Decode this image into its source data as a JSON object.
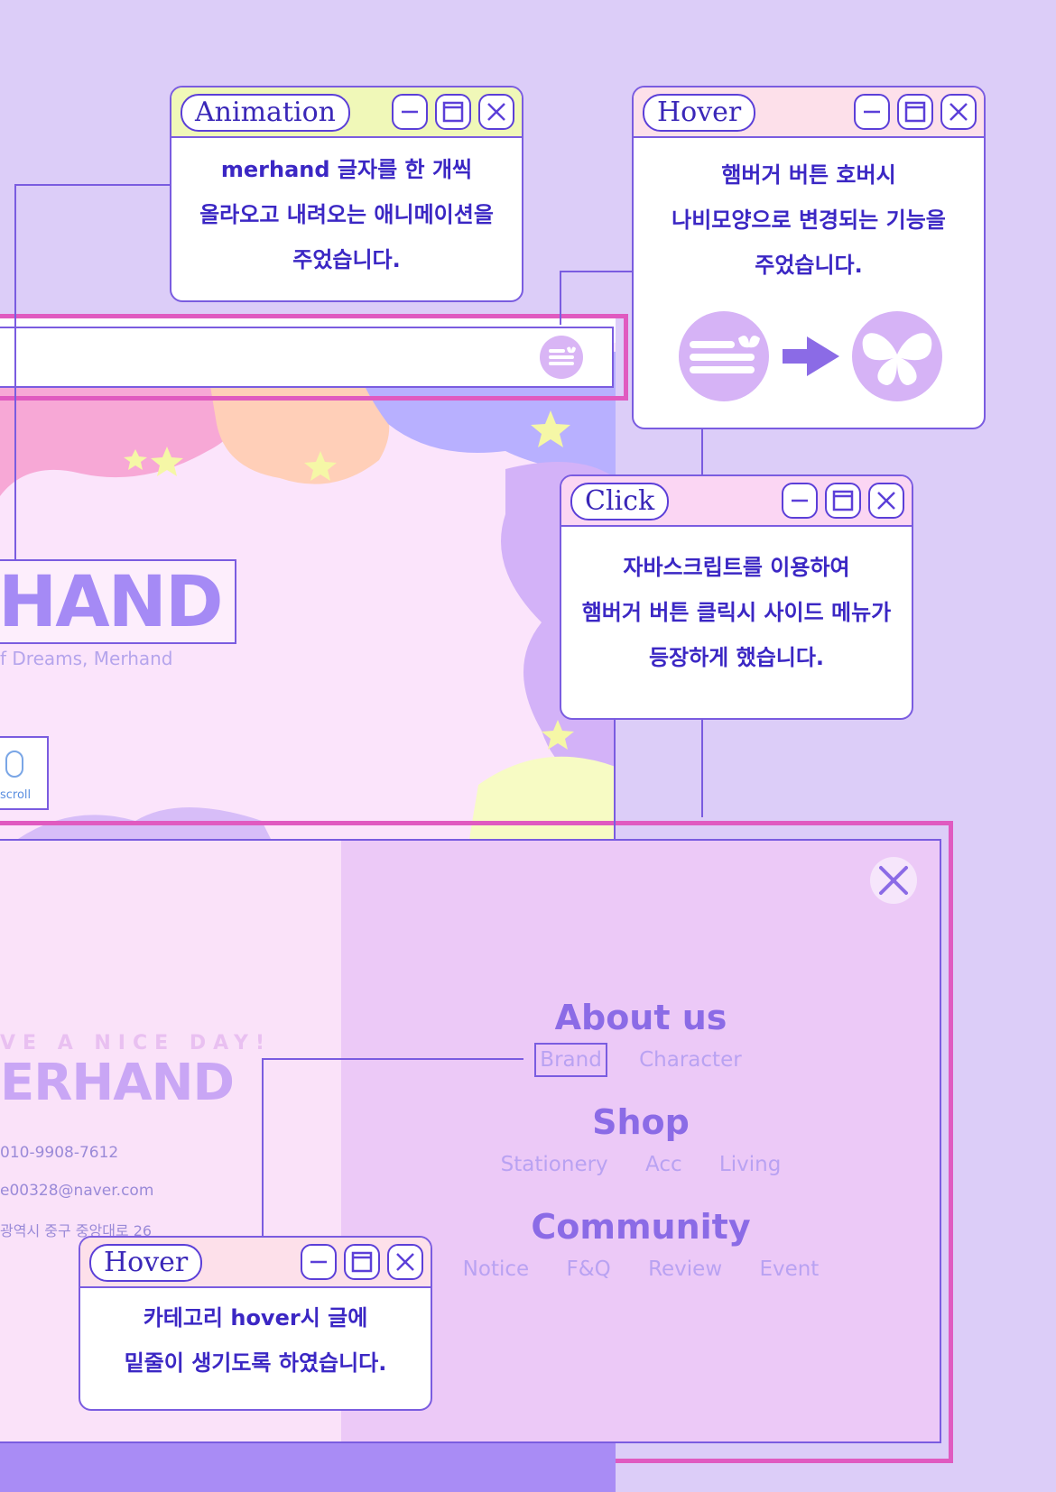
{
  "popups": {
    "animation": {
      "title": "Animation",
      "lines": [
        "merhand 글자를 한 개씩",
        "올라오고 내려오는 애니메이션을",
        "주었습니다."
      ]
    },
    "hover_top": {
      "title": "Hover",
      "lines": [
        "햄버거 버튼 호버시",
        "나비모양으로 변경되는 기능을",
        "주었습니다."
      ]
    },
    "click": {
      "title": "Click",
      "lines": [
        "자바스크립트를 이용하여",
        "햄버거 버튼 클릭시 사이드 메뉴가",
        "등장하게 했습니다."
      ]
    },
    "hover_bottom": {
      "title": "Hover",
      "lines": [
        "카테고리 hover시 글에",
        "밑줄이 생기도록 하였습니다."
      ]
    }
  },
  "hero": {
    "logo_partial": "HAND",
    "tagline_partial": "f Dreams, Merhand",
    "scroll_label": "scroll"
  },
  "side_menu": {
    "brand_script_top": "VE A NICE DAY!",
    "brand_logo_partial": "ERHAND",
    "contact": {
      "phone": "010-9908-7612",
      "email": "e00328@naver.com",
      "address": "광역시 중구 중앙대로 26"
    },
    "categories": [
      {
        "title": "About us",
        "subs": [
          "Brand",
          "Character"
        ]
      },
      {
        "title": "Shop",
        "subs": [
          "Stationery",
          "Acc",
          "Living"
        ]
      },
      {
        "title": "Community",
        "subs": [
          "Notice",
          "F&Q",
          "Review",
          "Event"
        ]
      }
    ]
  },
  "colors": {
    "background": "#dccdf8",
    "accent_line": "#7a5ce0",
    "highlight_frame": "#e05ac0",
    "popup_text": "#3b27c4",
    "menu_text": "#8b6be6"
  }
}
